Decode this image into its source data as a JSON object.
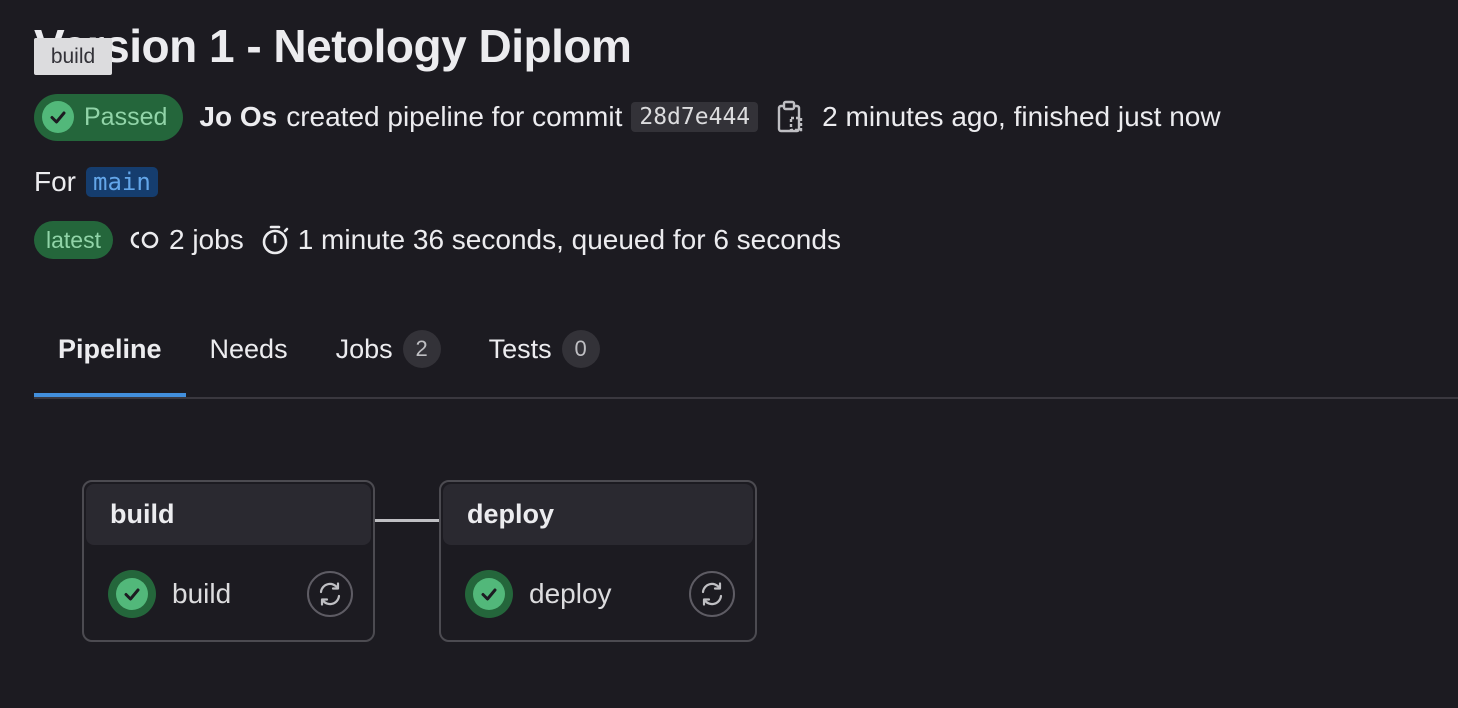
{
  "page": {
    "title": "Version 1 - Netology Diplom",
    "tooltip": "build"
  },
  "pipeline": {
    "status_label": "Passed",
    "author": "Jo Os",
    "created_text": "created pipeline for commit",
    "commit_sha": "28d7e444",
    "time_text": "2 minutes ago, finished just now",
    "for_label": "For",
    "branch": "main",
    "latest_badge": "latest",
    "jobs_count_text": "2 jobs",
    "duration_text": "1 minute 36 seconds, queued for 6 seconds"
  },
  "tabs": [
    {
      "label": "Pipeline",
      "active": true
    },
    {
      "label": "Needs"
    },
    {
      "label": "Jobs",
      "count": "2"
    },
    {
      "label": "Tests",
      "count": "0"
    }
  ],
  "stages": [
    {
      "name": "build",
      "job": {
        "name": "build",
        "status": "success-icon",
        "action": "retry-icon"
      }
    },
    {
      "name": "deploy",
      "job": {
        "name": "deploy",
        "status": "success-icon",
        "action": "retry-icon"
      }
    }
  ],
  "colors": {
    "background": "#1c1b21",
    "success": "#52b87a",
    "success_bg": "#24663b",
    "accent": "#428fdc"
  }
}
